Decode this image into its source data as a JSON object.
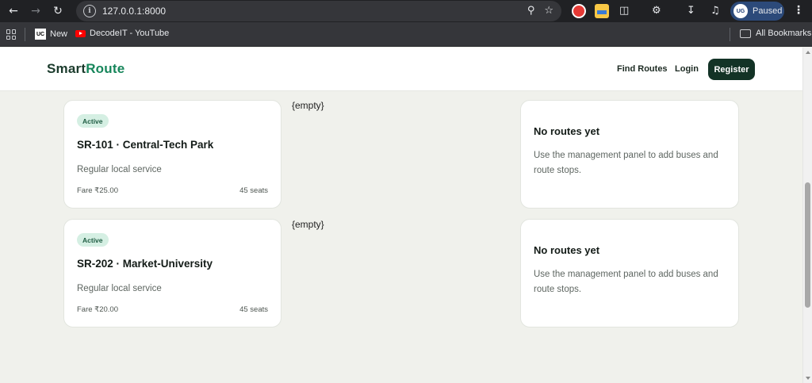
{
  "browser": {
    "url": "127.0.0.1:8000",
    "profile_initials": "UG",
    "profile_status": "Paused",
    "bookmarks": [
      {
        "label": "New",
        "icon": "uc-favicon"
      },
      {
        "label": "DecodeIT - YouTube",
        "icon": "youtube-favicon"
      }
    ],
    "all_bookmarks_label": "All Bookmarks"
  },
  "site": {
    "brand_part1": "Smart",
    "brand_part2": "Route",
    "brand_color_dark": "#1b3b2c",
    "brand_color_accent": "#17865b",
    "nav": {
      "find_routes": "Find Routes",
      "login": "Login",
      "register": "Register"
    }
  },
  "routes": [
    {
      "status": "Active",
      "title": "SR-101 · Central-Tech Park",
      "description": "Regular local service",
      "fare": "Fare ₹25.00",
      "seats": "45 seats",
      "stops_placeholder": "{empty}",
      "stops_title": "No routes yet",
      "stops_body": "Use the management panel to add buses and route stops."
    },
    {
      "status": "Active",
      "title": "SR-202 · Market-University",
      "description": "Regular local service",
      "fare": "Fare ₹20.00",
      "seats": "45 seats",
      "stops_placeholder": "{empty}",
      "stops_title": "No routes yet",
      "stops_body": "Use the management panel to add buses and route stops."
    }
  ]
}
